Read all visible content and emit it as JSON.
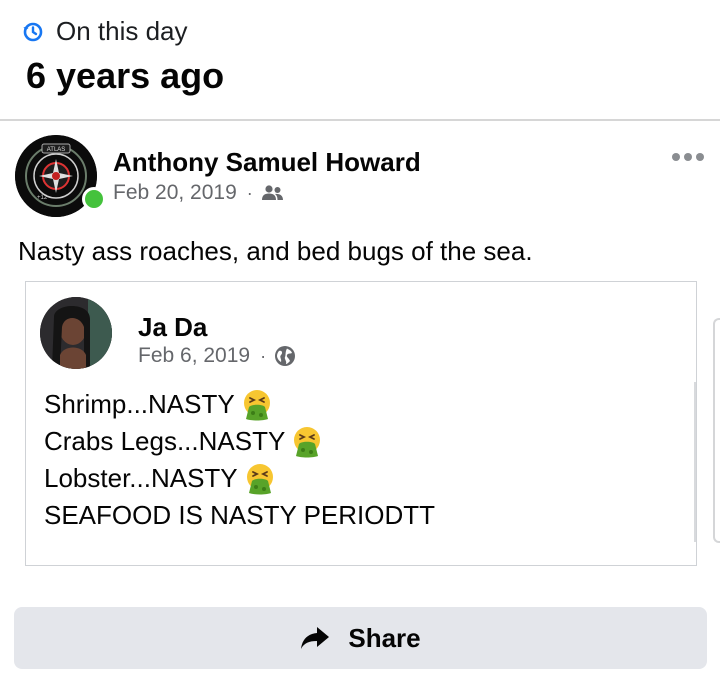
{
  "memory": {
    "label": "On this day",
    "title": "6 years ago",
    "clock_icon": "clock-history-icon"
  },
  "post": {
    "author": "Anthony Samuel Howard",
    "date": "Feb 20, 2019",
    "separator": "·",
    "audience_icon": "friends-icon",
    "online": true,
    "text": "Nasty ass roaches, and bed bugs of the sea.",
    "more_icon": "more-options-icon",
    "avatar_badge_text": "ATLAS",
    "avatar_number": "+12"
  },
  "shared": {
    "author": "Ja Da",
    "date": "Feb 6, 2019",
    "separator": "·",
    "audience_icon": "globe-icon",
    "lines": [
      {
        "text": "Shrimp...NASTY",
        "emoji": true
      },
      {
        "text": "Crabs Legs...NASTY",
        "emoji": true
      },
      {
        "text": "Lobster...NASTY",
        "emoji": true
      },
      {
        "text": "SEAFOOD IS NASTY PERIODTT",
        "emoji": false
      }
    ],
    "emoji_name": "face-vomiting-emoji"
  },
  "actions": {
    "share_label": "Share",
    "share_icon": "share-arrow-icon"
  },
  "colors": {
    "online": "#44c23c",
    "meta_text": "#65676b",
    "share_bg": "#e4e6eb",
    "clock_accent": "#1877f2"
  }
}
